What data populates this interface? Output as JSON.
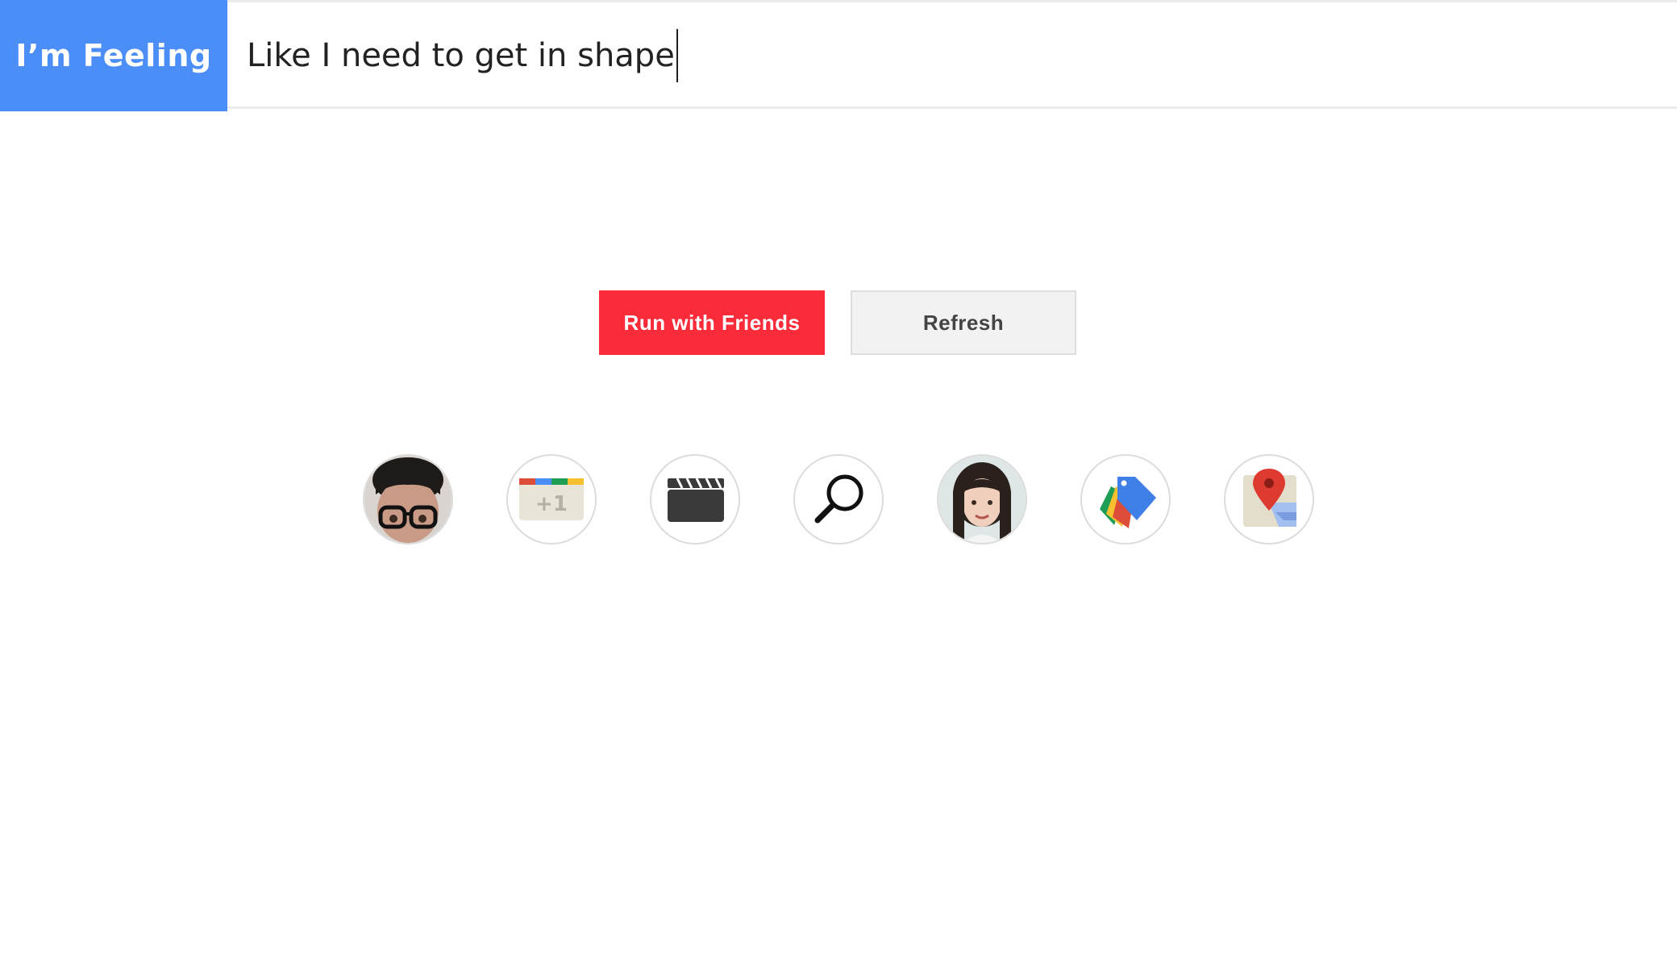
{
  "header": {
    "brand": "I’m Feeling",
    "query": "Like I need to get in shape"
  },
  "actions": {
    "primary_label": "Run with Friends",
    "secondary_label": "Refresh"
  },
  "icons": [
    {
      "name": "avatar-man-glasses"
    },
    {
      "name": "google-plus-one-calendar-icon"
    },
    {
      "name": "clapperboard-icon"
    },
    {
      "name": "search-icon"
    },
    {
      "name": "avatar-woman"
    },
    {
      "name": "google-shopping-tags-icon"
    },
    {
      "name": "google-maps-pin-icon"
    }
  ],
  "colors": {
    "brand_bg": "#4b8ef7",
    "primary_button": "#fb2c3a",
    "secondary_button": "#f2f2f2"
  }
}
